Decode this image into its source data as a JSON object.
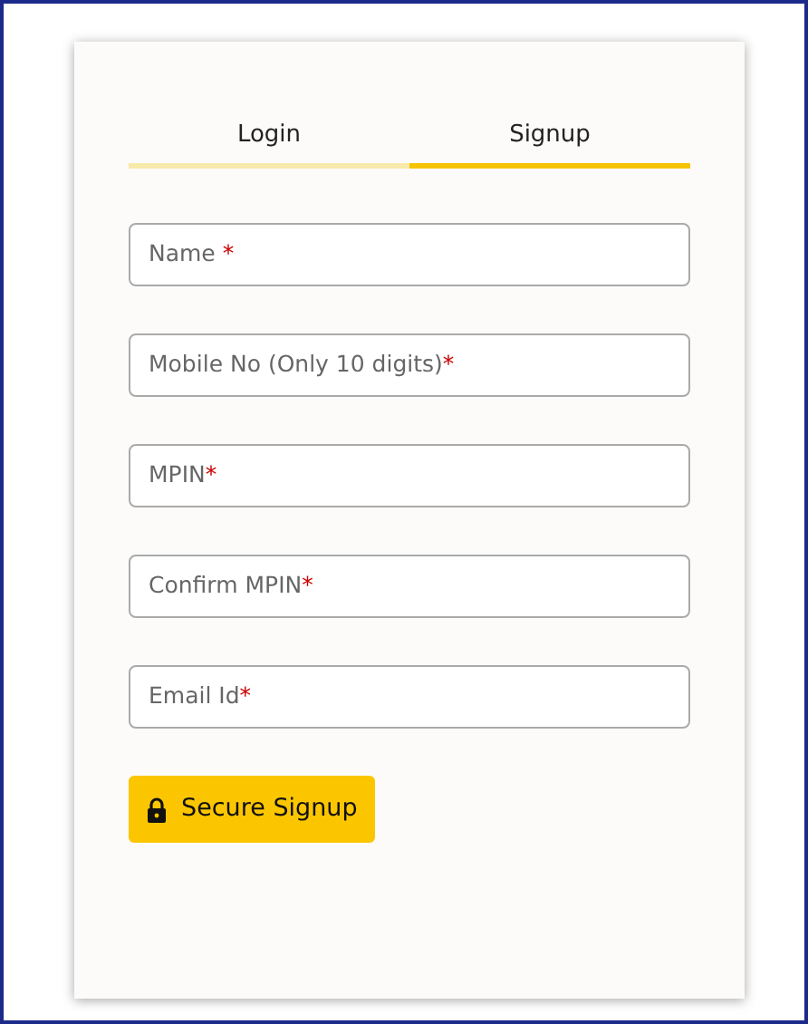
{
  "tabs": [
    {
      "label": "Login",
      "selected": false
    },
    {
      "label": "Signup",
      "selected": true
    }
  ],
  "fields": [
    {
      "placeholder": "Name",
      "marker": " *"
    },
    {
      "placeholder": "Mobile No (Only 10 digits)",
      "marker": "*"
    },
    {
      "placeholder": "MPIN",
      "marker": "*"
    },
    {
      "placeholder": "Confirm MPIN",
      "marker": "*"
    },
    {
      "placeholder": "Email Id",
      "marker": "*"
    }
  ],
  "submit_button": {
    "label": "Secure Signup"
  }
}
